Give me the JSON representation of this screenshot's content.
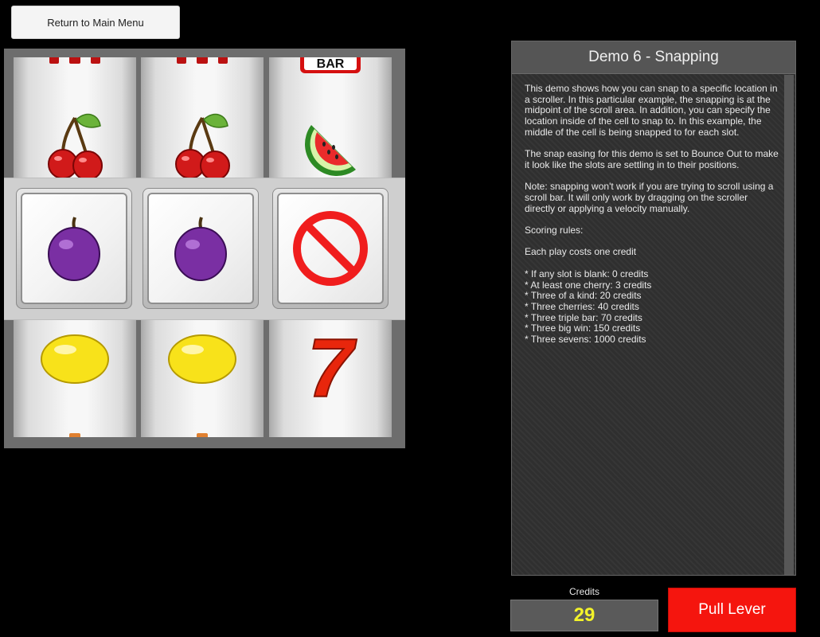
{
  "return_button": {
    "label": "Return to Main Menu"
  },
  "panel": {
    "title": "Demo 6 - Snapping",
    "paragraphs": [
      "This demo shows how you can snap to a specific location in a scroller. In this particular example, the snapping is at the midpoint of the scroll area. In addition, you can specify the location inside of the cell to snap to. In this example, the middle of the cell is being snapped to for each slot.",
      "The snap easing for this demo is set to Bounce Out to make it look like the slots are settling in to their positions.",
      "Note: snapping won't work if you are trying to scroll using a scroll bar. It will only work by dragging on the scroller directly or applying a velocity manually.",
      "Scoring rules:",
      "Each play costs one credit"
    ],
    "rules": [
      "* If any slot is blank: 0 credits",
      "* At least one cherry: 3 credits",
      "* Three of a kind: 20 credits",
      "* Three cherries: 40 credits",
      "* Three triple bar: 70 credits",
      "* Three big win: 150 credits",
      "* Three sevens: 1000 credits"
    ]
  },
  "credits": {
    "label": "Credits",
    "value": "29"
  },
  "pull_button": {
    "label": "Pull Lever"
  },
  "reels": [
    {
      "top": "big-win-icon",
      "upper": "cherry-icon",
      "center": "plum-icon",
      "lower": "lemon-icon"
    },
    {
      "top": "big-win-icon",
      "upper": "cherry-icon",
      "center": "plum-icon",
      "lower": "lemon-icon"
    },
    {
      "top": "bar-icon",
      "upper": "watermelon-icon",
      "center": "blank-icon",
      "lower": "seven-icon"
    }
  ],
  "bar_text": "BAR",
  "seven_text": "7",
  "colors": {
    "pull_button": "#f5150e",
    "credits_value": "#f2f22a",
    "panel_title_bg": "#555555"
  }
}
